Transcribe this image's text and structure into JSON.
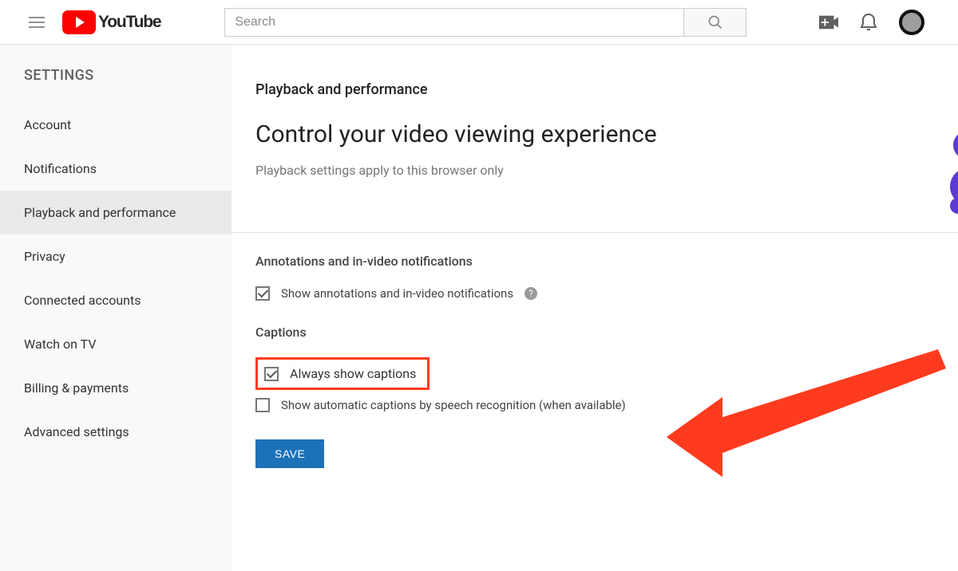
{
  "header": {
    "logo_text": "YouTube",
    "search_placeholder": "Search"
  },
  "sidebar": {
    "title": "SETTINGS",
    "items": [
      {
        "label": "Account"
      },
      {
        "label": "Notifications"
      },
      {
        "label": "Playback and performance"
      },
      {
        "label": "Privacy"
      },
      {
        "label": "Connected accounts"
      },
      {
        "label": "Watch on TV"
      },
      {
        "label": "Billing & payments"
      },
      {
        "label": "Advanced settings"
      }
    ]
  },
  "main": {
    "page_small_title": "Playback and performance",
    "page_big_title": "Control your video viewing experience",
    "page_subtitle": "Playback settings apply to this browser only",
    "annotations": {
      "section_label": "Annotations and in-video notifications",
      "checkbox_label": "Show annotations and in-video notifications",
      "help_symbol": "?"
    },
    "captions": {
      "section_label": "Captions",
      "always_label": "Always show captions",
      "auto_label": "Show automatic captions by speech recognition (when available)"
    },
    "save_label": "SAVE"
  },
  "colors": {
    "brand_red": "#ff0000",
    "highlight_red": "#ff3b1f",
    "save_blue": "#1b72b8"
  }
}
